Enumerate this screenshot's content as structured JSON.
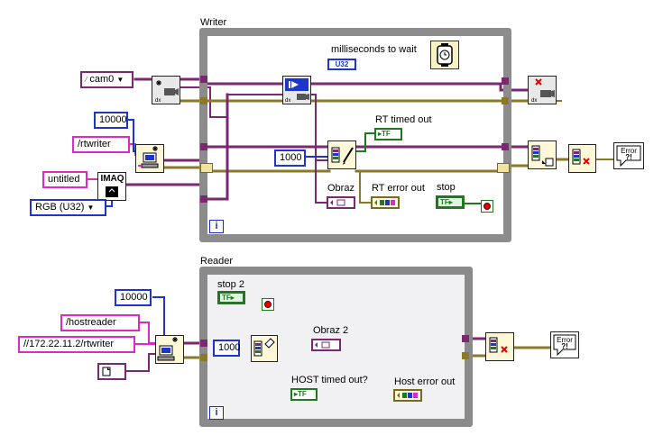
{
  "writer": {
    "title": "Writer",
    "iteration_symbol": "i",
    "ms_wait_label": "milliseconds to wait",
    "ms_wait_type": "U32",
    "camera_name": "cam0",
    "rtwriter_url": "/rtwriter",
    "buffer_size": "10000",
    "image_name": "untitled",
    "image_type": "RGB (U32)",
    "imaq_label": "IMAQ",
    "timeout_const": "1000",
    "rt_timed_out_label": "RT timed out",
    "obraz_label": "Obraz",
    "rt_error_label": "RT error out",
    "stop_label": "stop",
    "tf_text": "TF",
    "error_text": "Error"
  },
  "reader": {
    "title": "Reader",
    "iteration_symbol": "i",
    "stop_label": "stop 2",
    "buffer_size": "10000",
    "hostreader_url": "/hostreader",
    "remote_url": "//172.22.11.2/rtwriter",
    "timeout_const": "1000",
    "obraz_label": "Obraz  2",
    "host_timed_out_label": "HOST timed out?",
    "host_error_label": "Host error out",
    "tf_text": "TF",
    "error_text": "Error"
  },
  "colors": {
    "wire_purple": "#7a2870",
    "wire_pink": "#e028c8",
    "wire_blue": "#1d35c8",
    "wire_error": "#8a7a28",
    "wire_bool": "#1f7a1f",
    "loop_border": "#8c8c8c"
  }
}
